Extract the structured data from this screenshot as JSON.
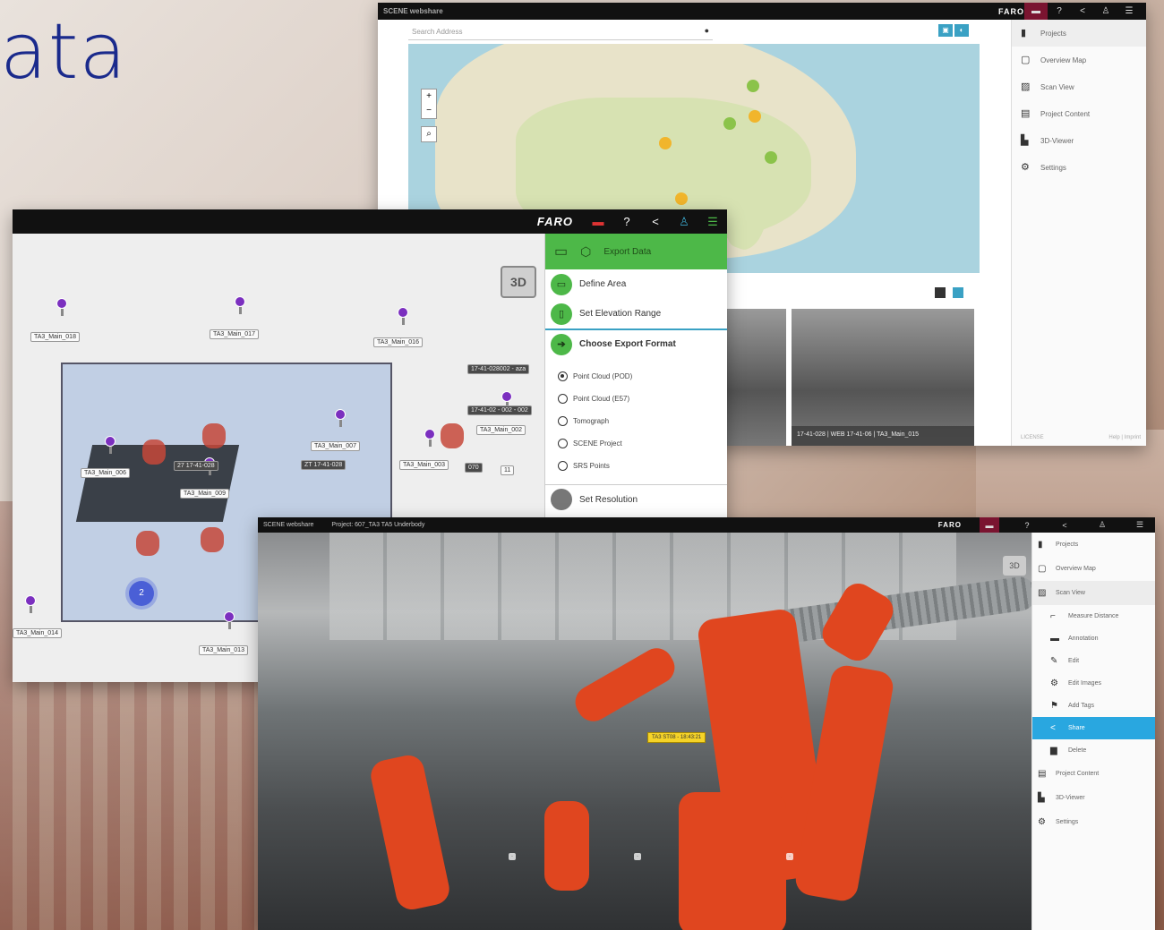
{
  "title": "ata",
  "map_window": {
    "brand": "SCENE webshare",
    "logo": "FARO",
    "toolbar_icons": [
      "flag-icon",
      "help-icon",
      "share-icon",
      "user-icon",
      "menu-icon"
    ],
    "search_placeholder": "Search Address",
    "zoom_in": "+",
    "zoom_out": "−",
    "zoom_search": "⌕",
    "sidebar": [
      {
        "label": "Projects",
        "icon": "book-icon"
      },
      {
        "label": "Overview Map",
        "icon": "map-icon"
      },
      {
        "label": "Scan View",
        "icon": "image-icon"
      },
      {
        "label": "Project Content",
        "icon": "list-icon"
      },
      {
        "label": "3D-Viewer",
        "icon": "cube-icon"
      },
      {
        "label": "Settings",
        "icon": "gear-icon"
      }
    ],
    "footer_left": "LICENSE",
    "footer_right": "Help | Imprint",
    "thumb_caption": "17-41-028 | WEB 17-41-06 | TA3_Main_015"
  },
  "plan_window": {
    "logo": "FARO",
    "toolbar_icons": [
      "flag-icon",
      "help-icon",
      "share-icon",
      "user-icon",
      "menu-icon"
    ],
    "btn_3d": "3D",
    "panel_title": "Export Data",
    "steps": [
      {
        "label": "Define Area",
        "icon": "area-icon"
      },
      {
        "label": "Set Elevation Range",
        "icon": "elevation-icon"
      },
      {
        "label": "Choose Export Format",
        "icon": "arrow-right-icon"
      }
    ],
    "formats": [
      {
        "label": "Point Cloud (POD)",
        "selected": true
      },
      {
        "label": "Point Cloud (E57)",
        "selected": false
      },
      {
        "label": "Tomograph",
        "selected": false
      },
      {
        "label": "SCENE Project",
        "selected": false
      },
      {
        "label": "SRS Points",
        "selected": false
      }
    ],
    "resolution": "Set Resolution",
    "scan_tags": [
      "TA3_Main_018",
      "TA3_Main_017",
      "TA3_Main_016",
      "TA3_Main_007",
      "TA3_Main_006",
      "TA3_Main_009",
      "TA3_Main_003",
      "TA3_Main_002",
      "TA3_Main_014",
      "TA3_Main_013",
      "17-41-028002 - aza",
      "17-41-02 - 002 - 002",
      "27 17-41-028",
      "ZT 17-41-028",
      "070",
      "11"
    ],
    "cluster_count": "2"
  },
  "scan_window": {
    "brand": "SCENE webshare",
    "project": "Project: 607_TA3 TA5 Underbody",
    "logo": "FARO",
    "btn_3d": "3D",
    "yellow_tag": "TA3 ST08 - 18:43:21",
    "sidebar": [
      {
        "label": "Projects",
        "icon": "book-icon",
        "type": "main"
      },
      {
        "label": "Overview Map",
        "icon": "map-icon",
        "type": "main"
      },
      {
        "label": "Scan View",
        "icon": "image-icon",
        "type": "sel"
      },
      {
        "label": "Measure Distance",
        "icon": "measure-icon",
        "type": "sub"
      },
      {
        "label": "Annotation",
        "icon": "comment-icon",
        "type": "sub"
      },
      {
        "label": "Edit",
        "icon": "pencil-icon",
        "type": "sub"
      },
      {
        "label": "Edit Images",
        "icon": "images-icon",
        "type": "sub"
      },
      {
        "label": "Add Tags",
        "icon": "tag-icon",
        "type": "sub"
      },
      {
        "label": "Share",
        "icon": "share-icon",
        "type": "hl"
      },
      {
        "label": "Delete",
        "icon": "trash-icon",
        "type": "sub"
      },
      {
        "label": "Project Content",
        "icon": "list-icon",
        "type": "main"
      },
      {
        "label": "3D-Viewer",
        "icon": "cube-icon",
        "type": "main"
      },
      {
        "label": "Settings",
        "icon": "gear-icon",
        "type": "main"
      }
    ]
  }
}
